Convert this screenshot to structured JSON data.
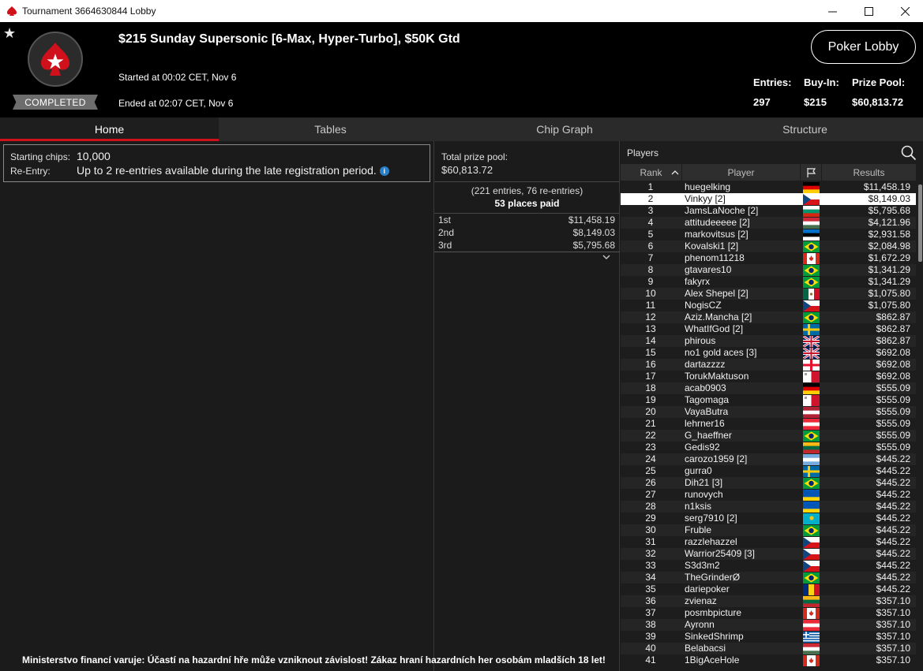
{
  "window": {
    "title": "Tournament 3664630844 Lobby",
    "controls": [
      "minimize-icon",
      "maximize-icon",
      "close-icon"
    ]
  },
  "header": {
    "tournament_name": "$215 Sunday Supersonic [6-Max, Hyper-Turbo], $50K Gtd",
    "started": "Started at 00:02 CET, Nov 6",
    "ended": "Ended at 02:07 CET, Nov 6",
    "status_badge": "COMPLETED",
    "lobby_button": "Poker Lobby",
    "stats": {
      "entries_label": "Entries:",
      "entries_value": "297",
      "buyin_label": "Buy-In:",
      "buyin_value": "$215",
      "prizepool_label": "Prize Pool:",
      "prizepool_value": "$60,813.72"
    },
    "colors": {
      "brand_red": "#d0101b",
      "background": "#000000"
    }
  },
  "tabs": [
    {
      "label": "Home",
      "active": true
    },
    {
      "label": "Tables",
      "active": false
    },
    {
      "label": "Chip Graph",
      "active": false
    },
    {
      "label": "Structure",
      "active": false
    }
  ],
  "info": {
    "starting_chips_label": "Starting chips:",
    "starting_chips_value": "10,000",
    "reentry_label": "Re-Entry:",
    "reentry_value": "Up to 2 re-entries available during the late registration period."
  },
  "prize": {
    "total_label": "Total prize pool:",
    "total_value": "$60,813.72",
    "entries_detail": "(221 entries, 76 re-entries)",
    "places_paid": "53 places paid",
    "places": [
      {
        "place": "1st",
        "amount": "$11,458.19"
      },
      {
        "place": "2nd",
        "amount": "$8,149.03"
      },
      {
        "place": "3rd",
        "amount": "$5,795.68"
      }
    ]
  },
  "players": {
    "title": "Players",
    "columns": {
      "rank": "Rank",
      "player": "Player",
      "results": "Results"
    },
    "selected_rank": 2,
    "rows": [
      {
        "rank": "1",
        "name": "huegelking",
        "flag": "de",
        "result": "$11,458.19"
      },
      {
        "rank": "2",
        "name": "Vinkyy [2]",
        "flag": "cz",
        "result": "$8,149.03"
      },
      {
        "rank": "3",
        "name": "JamsLaNoche [2]",
        "flag": "bg",
        "result": "$5,795.68"
      },
      {
        "rank": "4",
        "name": "attitudeeeee [2]",
        "flag": "hu",
        "result": "$4,121.96"
      },
      {
        "rank": "5",
        "name": "markovitsus [2]",
        "flag": "ee",
        "result": "$2,931.58"
      },
      {
        "rank": "6",
        "name": "Kovalski1 [2]",
        "flag": "br",
        "result": "$2,084.98"
      },
      {
        "rank": "7",
        "name": "phenom11218",
        "flag": "ca",
        "result": "$1,672.29"
      },
      {
        "rank": "8",
        "name": "gtavares10",
        "flag": "br",
        "result": "$1,341.29"
      },
      {
        "rank": "9",
        "name": "fakyrx",
        "flag": "br",
        "result": "$1,341.29"
      },
      {
        "rank": "10",
        "name": "Alex Shepel [2]",
        "flag": "mx",
        "result": "$1,075.80"
      },
      {
        "rank": "11",
        "name": "NogisCZ",
        "flag": "cz",
        "result": "$1,075.80"
      },
      {
        "rank": "12",
        "name": "Aziz.Mancha [2]",
        "flag": "br",
        "result": "$862.87"
      },
      {
        "rank": "13",
        "name": "WhatIfGod [2]",
        "flag": "se",
        "result": "$862.87"
      },
      {
        "rank": "14",
        "name": "phirous",
        "flag": "gb",
        "result": "$862.87"
      },
      {
        "rank": "15",
        "name": "no1 gold aces [3]",
        "flag": "gb",
        "result": "$692.08"
      },
      {
        "rank": "16",
        "name": "dartazzzz",
        "flag": "ge",
        "result": "$692.08"
      },
      {
        "rank": "17",
        "name": "TorukMaktuson",
        "flag": "mt",
        "result": "$692.08"
      },
      {
        "rank": "18",
        "name": "acab0903",
        "flag": "de",
        "result": "$555.09"
      },
      {
        "rank": "19",
        "name": "Tagomaga",
        "flag": "mt",
        "result": "$555.09"
      },
      {
        "rank": "20",
        "name": "VayaButra",
        "flag": "us",
        "result": "$555.09"
      },
      {
        "rank": "21",
        "name": "lehrner16",
        "flag": "at",
        "result": "$555.09"
      },
      {
        "rank": "22",
        "name": "G_haeffner",
        "flag": "br",
        "result": "$555.09"
      },
      {
        "rank": "23",
        "name": "Gedis92",
        "flag": "lt",
        "result": "$555.09"
      },
      {
        "rank": "24",
        "name": "carozo1959 [2]",
        "flag": "ar",
        "result": "$445.22"
      },
      {
        "rank": "25",
        "name": "gurra0",
        "flag": "se",
        "result": "$445.22"
      },
      {
        "rank": "26",
        "name": "Dih21 [3]",
        "flag": "br",
        "result": "$445.22"
      },
      {
        "rank": "27",
        "name": "runovych",
        "flag": "ua",
        "result": "$445.22"
      },
      {
        "rank": "28",
        "name": "n1ksis",
        "flag": "ua",
        "result": "$445.22"
      },
      {
        "rank": "29",
        "name": "serg7910 [2]",
        "flag": "kz",
        "result": "$445.22"
      },
      {
        "rank": "30",
        "name": "Fruble",
        "flag": "br",
        "result": "$445.22"
      },
      {
        "rank": "31",
        "name": "razzlehazzel",
        "flag": "cz",
        "result": "$445.22"
      },
      {
        "rank": "32",
        "name": "Warrior25409 [3]",
        "flag": "cz",
        "result": "$445.22"
      },
      {
        "rank": "33",
        "name": "S3d3m2",
        "flag": "cz",
        "result": "$445.22"
      },
      {
        "rank": "34",
        "name": "TheGrinderØ",
        "flag": "br",
        "result": "$445.22"
      },
      {
        "rank": "35",
        "name": "dariepoker",
        "flag": "ro",
        "result": "$445.22"
      },
      {
        "rank": "36",
        "name": "zvienaz",
        "flag": "lt",
        "result": "$357.10"
      },
      {
        "rank": "37",
        "name": "posmbpicture",
        "flag": "ca",
        "result": "$357.10"
      },
      {
        "rank": "38",
        "name": "Ayronn",
        "flag": "at",
        "result": "$357.10"
      },
      {
        "rank": "39",
        "name": "SinkedShrimp",
        "flag": "gr",
        "result": "$357.10"
      },
      {
        "rank": "40",
        "name": "Belabacsi",
        "flag": "hu",
        "result": "$357.10"
      },
      {
        "rank": "41",
        "name": "1BigAceHole",
        "flag": "ca",
        "result": "$357.10"
      }
    ]
  },
  "warning": "Ministerstvo financí varuje: Účastí na hazardní hře může vzniknout závislost! Zákaz hraní hazardních her osobám mladších 18 let!"
}
